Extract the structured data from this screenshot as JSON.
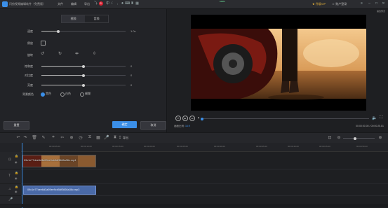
{
  "titlebar": {
    "app_title": "闪剪视频编辑软件（免费版）",
    "menus": [
      "文件",
      "编辑",
      "导出"
    ],
    "member_label": "升级VIP",
    "account_label": "账户登录",
    "memory": "100%"
  },
  "panel": {
    "tabs": [
      "视频",
      "音频"
    ],
    "active_tab": 0,
    "speed_label": "速度",
    "speed_value": "1.0x",
    "speed_level": 0.2,
    "reverse_label": "倒放",
    "rotate_label": "旋转",
    "saturation_label": "饱和度",
    "saturation_value": "0",
    "saturation_level": 0.5,
    "contrast_label": "对比度",
    "contrast_value": "0",
    "contrast_level": 0.5,
    "brightness_label": "亮度",
    "brightness_value": "0",
    "brightness_level": 0.5,
    "bgcolor_label": "背景颜色",
    "bg_options": [
      "黑色",
      "白色",
      "模糊"
    ],
    "bg_selected": 0,
    "reset_label": "重置",
    "ok_label": "确定",
    "cancel_label": "取消"
  },
  "preview": {
    "label": "播放预览",
    "ratio_label": "画面比例:",
    "ratio_value": "16:9",
    "time": "00:00:00.00 / 00:00:25.81",
    "progress": 0.0
  },
  "toolbar": {
    "export_label": "导出"
  },
  "ruler": {
    "ticks": [
      "00:00:00.00",
      "00:00:05.00",
      "00:00:10.00",
      "00:00:15.00",
      "00:00:20.00",
      "00:00:25.00",
      "00:00:30.00",
      "00:00:35.00",
      "00:00:40.00",
      "00:00:45.00",
      "00:00:50.00"
    ]
  },
  "timeline": {
    "video_clip_name": "09c1e77dee6d3a59ee9cb5df3666a36c.mp4",
    "audio_clip_name": "09c1e77dee6d3a59ee9cb5df3666a36c.mp3"
  },
  "colors": {
    "accent": "#3b8fe8",
    "background": "#1e1f22"
  }
}
